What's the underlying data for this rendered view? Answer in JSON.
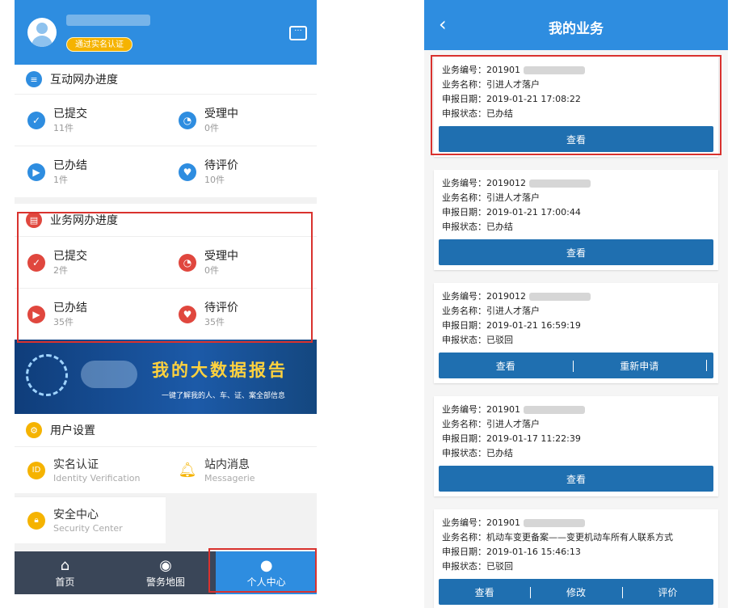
{
  "left": {
    "header": {
      "verify_badge": "通过实名认证"
    },
    "internet_progress": {
      "title": "互动网办进度",
      "items": [
        {
          "label": "已提交",
          "count": "11件",
          "icon": "check-icon"
        },
        {
          "label": "受理中",
          "count": "0件",
          "icon": "pie-icon"
        },
        {
          "label": "已办结",
          "count": "1件",
          "icon": "flag-icon"
        },
        {
          "label": "待评价",
          "count": "10件",
          "icon": "thumb-icon"
        }
      ]
    },
    "business_progress": {
      "title": "业务网办进度",
      "items": [
        {
          "label": "已提交",
          "count": "2件",
          "icon": "check-icon"
        },
        {
          "label": "受理中",
          "count": "0件",
          "icon": "pie-icon"
        },
        {
          "label": "已办结",
          "count": "35件",
          "icon": "flag-icon"
        },
        {
          "label": "待评价",
          "count": "35件",
          "icon": "thumb-icon"
        }
      ]
    },
    "banner": {
      "title": "我的大数据报告",
      "subtitle": "一键了解我的人、车、证、案全部信息"
    },
    "settings": {
      "title": "用户设置",
      "realname": {
        "label": "实名认证",
        "sub": "Identity Verification"
      },
      "messages": {
        "label": "站内消息",
        "sub": "Messagerie"
      },
      "security": {
        "label": "安全中心",
        "sub": "Security Center"
      }
    },
    "tabs": [
      "首页",
      "警务地图",
      "个人中心"
    ],
    "colors": {
      "primary": "#2e8de0",
      "danger": "#e0473e",
      "warning": "#f5b300",
      "tabbar": "#3a4658"
    }
  },
  "right": {
    "title": "我的业务",
    "labels": {
      "no": "业务编号：",
      "name": "业务名称：",
      "date": "申报日期：",
      "status": "申报状态："
    },
    "cards": [
      {
        "no": "201901",
        "name": "引进人才落户",
        "date": "2019-01-21 17:08:22",
        "status": "已办结",
        "buttons": [
          "查看"
        ]
      },
      {
        "no": "2019012",
        "name": "引进人才落户",
        "date": "2019-01-21 17:00:44",
        "status": "已办结",
        "buttons": [
          "查看"
        ]
      },
      {
        "no": "2019012",
        "name": "引进人才落户",
        "date": "2019-01-21 16:59:19",
        "status": "已驳回",
        "buttons": [
          "查看",
          "重新申请"
        ]
      },
      {
        "no": "201901",
        "name": "引进人才落户",
        "date": "2019-01-17 11:22:39",
        "status": "已办结",
        "buttons": [
          "查看"
        ]
      },
      {
        "no": "201901",
        "name": "机动车变更备案——变更机动车所有人联系方式",
        "date": "2019-01-16 15:46:13",
        "status": "已驳回",
        "buttons": [
          "查看",
          "修改",
          "评价"
        ]
      }
    ]
  }
}
